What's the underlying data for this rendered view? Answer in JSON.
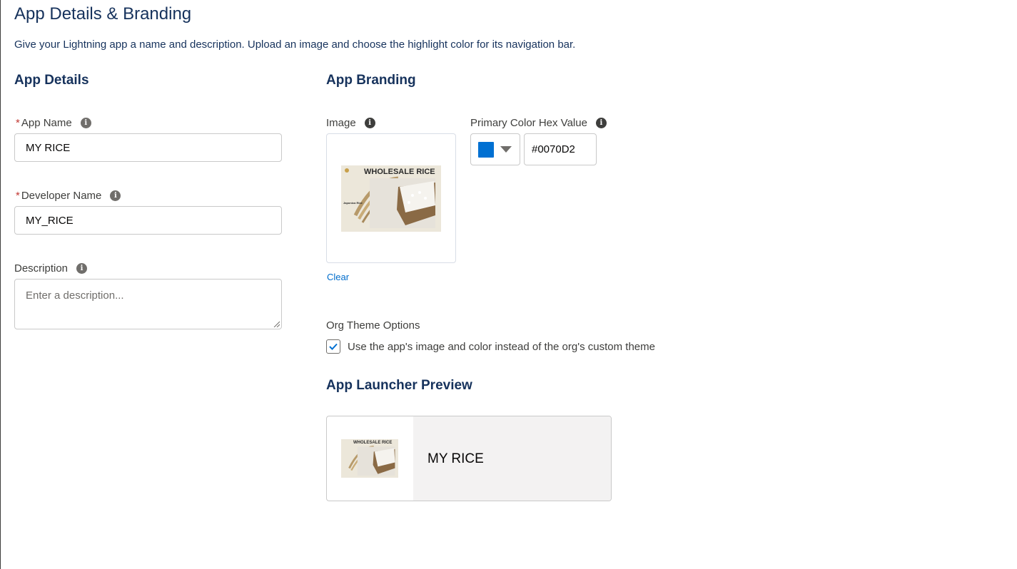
{
  "page": {
    "title": "App Details & Branding",
    "subtitle": "Give your Lightning app a name and description. Upload an image and choose the highlight color for its navigation bar."
  },
  "details": {
    "section_title": "App Details",
    "app_name_label": "App Name",
    "app_name_value": "MY RICE",
    "developer_name_label": "Developer Name",
    "developer_name_value": "MY_RICE",
    "description_label": "Description",
    "description_placeholder": "Enter a description...",
    "required_marker": "*",
    "info_glyph": "i"
  },
  "branding": {
    "section_title": "App Branding",
    "image_label": "Image",
    "image_title_text": "WHOLESALE RICE",
    "image_subtext": "Japonica Rice",
    "clear_label": "Clear",
    "color_label": "Primary Color Hex Value",
    "color_hex": "#0070D2",
    "org_theme_label": "Org Theme Options",
    "org_theme_checkbox_label": "Use the app's image and color instead of the org's custom theme",
    "org_theme_checked": true
  },
  "preview": {
    "section_title": "App Launcher Preview",
    "app_name": "MY RICE"
  },
  "colors": {
    "heading": "#16325c",
    "link": "#006dcc",
    "brand": "#0070d2",
    "required": "#c23934"
  },
  "icons": [
    "info-icon",
    "checkmark-icon",
    "chevron-down-icon"
  ]
}
